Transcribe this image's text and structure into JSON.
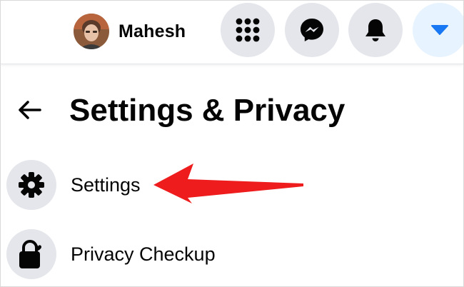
{
  "header": {
    "profile_name": "Mahesh",
    "icons": {
      "menu": "menu-grid-icon",
      "messenger": "messenger-icon",
      "notifications": "bell-icon",
      "account": "caret-down-icon"
    }
  },
  "panel": {
    "title": "Settings & Privacy",
    "back_icon": "back-arrow-icon",
    "items": [
      {
        "label": "Settings",
        "icon": "gear-icon"
      },
      {
        "label": "Privacy Checkup",
        "icon": "lock-heart-icon"
      }
    ]
  },
  "annotation": {
    "arrow_color": "#ee1c1c",
    "points_to": "Settings"
  },
  "colors": {
    "brand_blue": "#1877f2",
    "button_bg": "#e4e6eb",
    "active_button_bg": "#e7f3ff",
    "text": "#050505"
  }
}
